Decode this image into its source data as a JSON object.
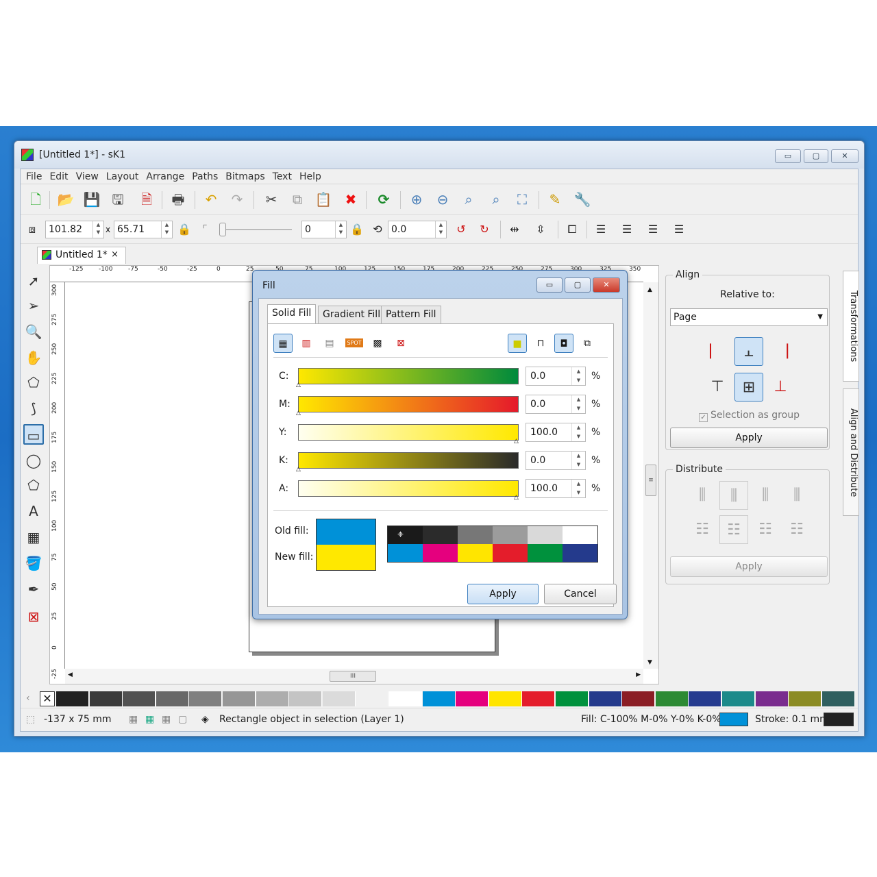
{
  "window": {
    "title": "[Untitled 1*] - sK1",
    "min": "▭",
    "max": "▢",
    "close": "✕"
  },
  "menu": [
    "File",
    "Edit",
    "View",
    "Layout",
    "Arrange",
    "Paths",
    "Bitmaps",
    "Text",
    "Help"
  ],
  "propbar": {
    "width": "101.82",
    "height": "65.71",
    "angle": "0",
    "rotation": "0.0",
    "times": "x"
  },
  "doc_tab": {
    "label": "Untitled 1*",
    "close": "×"
  },
  "hruler": [
    "-125",
    "-100",
    "-75",
    "-50",
    "-25",
    "0",
    "25",
    "50",
    "75",
    "100",
    "125",
    "150",
    "175",
    "200",
    "225",
    "250",
    "275",
    "300",
    "325",
    "350"
  ],
  "vruler": [
    "300",
    "275",
    "250",
    "225",
    "200",
    "175",
    "150",
    "125",
    "100",
    "75",
    "50",
    "25",
    "0",
    "-25"
  ],
  "align_panel": {
    "title": "Align",
    "relative_label": "Relative to:",
    "relative_value": "Page",
    "selection_group": "Selection as group",
    "apply": "Apply",
    "distribute_title": "Distribute",
    "distribute_apply": "Apply"
  },
  "side_tabs": {
    "transformations": "Transformations",
    "align_distribute": "Align and Distribute"
  },
  "palette": {
    "colors": [
      "#222222",
      "#3a3a3a",
      "#515151",
      "#686868",
      "#7f7f7f",
      "#969696",
      "#adadad",
      "#c4c4c4",
      "#dbdbdb",
      "#f0f0f0",
      "#ffffff",
      "#0091d8",
      "#e5007e",
      "#ffe500",
      "#e41d2b",
      "#00913d",
      "#243a8c",
      "#8b1e25",
      "#2d8a34",
      "#263b8f",
      "#1c8a8a",
      "#7a2c8e",
      "#8c8c24",
      "#2f5f5f"
    ]
  },
  "status": {
    "size": "-137 x 75 mm",
    "message": "Rectangle object in selection (Layer 1)",
    "fill": "Fill: C-100% M-0% Y-0% K-0%",
    "fill_color": "#0091d8",
    "stroke": "Stroke: 0.1 mm",
    "stroke_color": "#222222"
  },
  "dialog": {
    "title": "Fill",
    "tabs": [
      "Solid Fill",
      "Gradient Fill",
      "Pattern Fill"
    ],
    "channels": [
      {
        "label": "C:",
        "value": "0.0",
        "pct": "%",
        "from": "#ffe800",
        "to": "#008a3c",
        "marker": 0
      },
      {
        "label": "M:",
        "value": "0.0",
        "pct": "%",
        "from": "#ffe800",
        "to": "#e5192b",
        "marker": 0
      },
      {
        "label": "Y:",
        "value": "100.0",
        "pct": "%",
        "from": "#fffff0",
        "to": "#ffe800",
        "marker": 1
      },
      {
        "label": "K:",
        "value": "0.0",
        "pct": "%",
        "from": "#ffe800",
        "to": "#2a2a2a",
        "marker": 0
      },
      {
        "label": "A:",
        "value": "100.0",
        "pct": "%",
        "from": "#fffff0",
        "to": "#ffe800",
        "marker": 1
      }
    ],
    "old_fill_label": "Old fill:",
    "new_fill_label": "New fill:",
    "old_fill": "#0091d8",
    "new_fill": "#ffe800",
    "mini_palette": [
      "#1a1a1a",
      "#2b2b2b",
      "#777777",
      "#9c9c9c",
      "#d9d9d9",
      "#ffffff",
      "#0091d8",
      "#e5007e",
      "#ffe500",
      "#e41d2b",
      "#00913d",
      "#243a8c"
    ],
    "apply": "Apply",
    "cancel": "Cancel",
    "spot": "SPOT"
  }
}
